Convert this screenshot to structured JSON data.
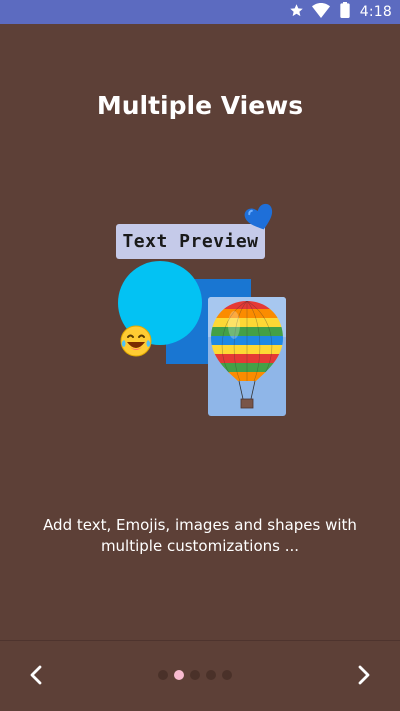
{
  "status_bar": {
    "time": "4:18",
    "icons": [
      "star-icon",
      "wifi-icon",
      "battery-icon"
    ],
    "background": "#5c6bc0"
  },
  "screen": {
    "background": "#5d4037",
    "title": "Multiple Views",
    "description": "Add text, Emojis, images and shapes with multiple customizations ..."
  },
  "illustration": {
    "text_preview_label": "Text Preview",
    "text_preview_color": "#c5cae9",
    "circle_color": "#03c2f3",
    "square_color": "#1976d2",
    "stickers": [
      "heart-icon",
      "laughing-emoji-icon"
    ],
    "image": "hot-air-balloon"
  },
  "pager": {
    "total_pages": 5,
    "active_index": 1,
    "active_color": "#f8bbd0",
    "prev_icon": "chevron-left-icon",
    "next_icon": "chevron-right-icon"
  }
}
